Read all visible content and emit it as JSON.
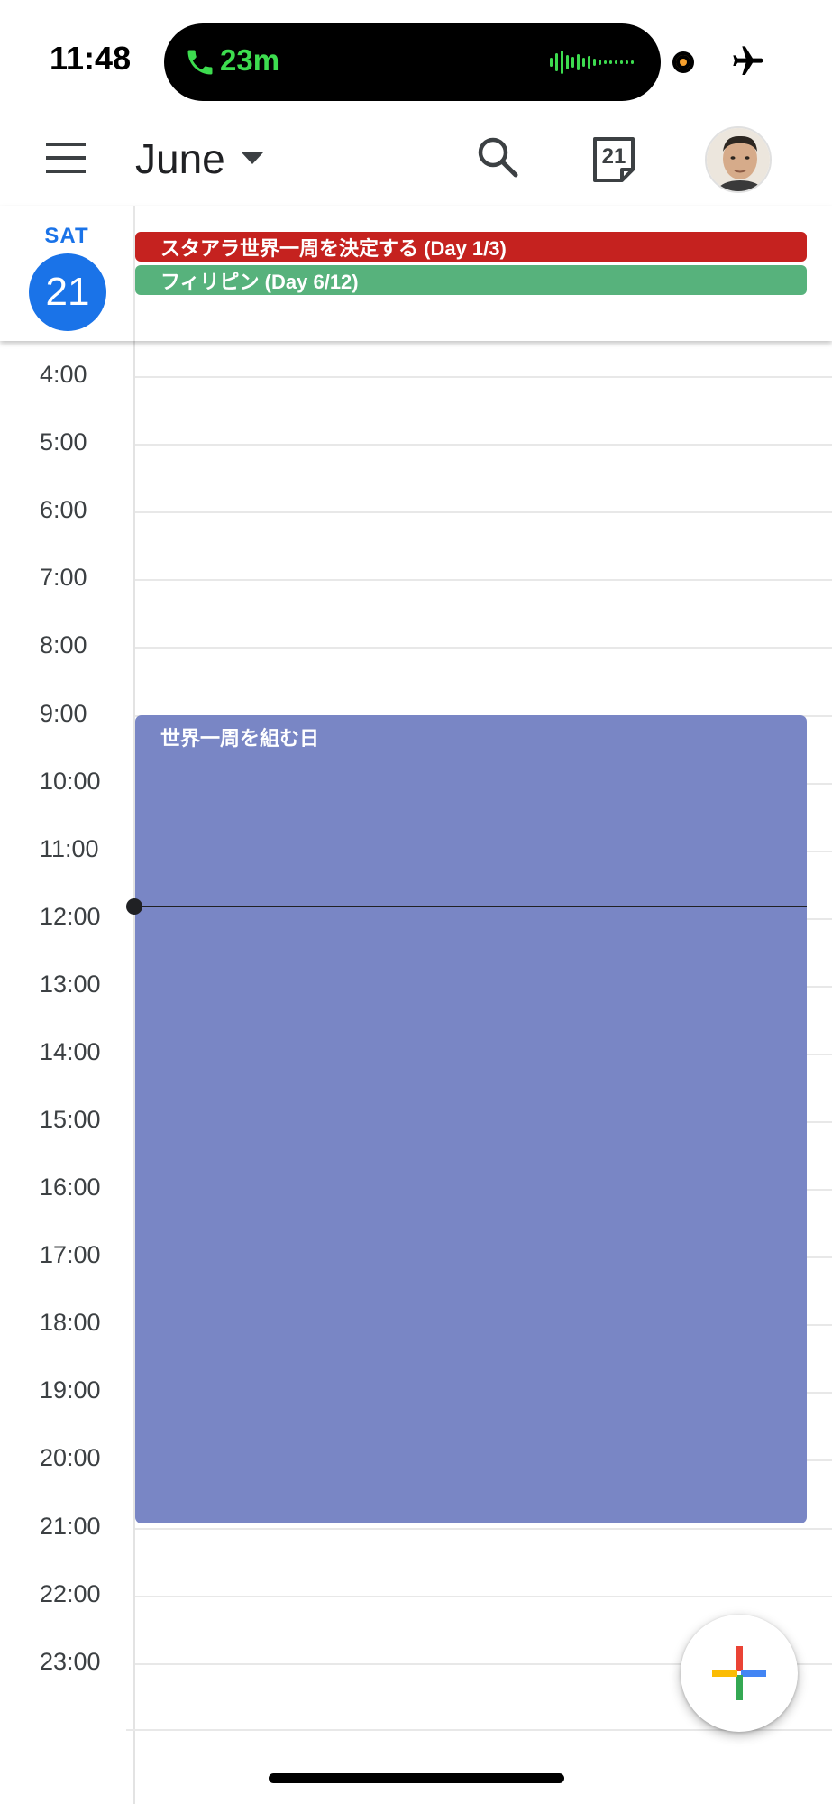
{
  "status_bar": {
    "time": "11:48",
    "call_duration": "23m",
    "icons": [
      "phone-icon",
      "audio-wave-icon",
      "orange-dot-icon",
      "airplane-icon"
    ]
  },
  "app_bar": {
    "month": "June",
    "icons": [
      "menu-icon",
      "dropdown-caret-icon",
      "search-icon",
      "today-calendar-icon",
      "avatar"
    ],
    "today_date": "21"
  },
  "day": {
    "weekday": "SAT",
    "number": "21"
  },
  "all_day_events": [
    {
      "title": "スタアラ世界一周を決定する (Day 1/3)",
      "color": "#c5221f"
    },
    {
      "title": "フィリピン (Day 6/12)",
      "color": "#57b27c"
    }
  ],
  "hours": [
    "4:00",
    "5:00",
    "6:00",
    "7:00",
    "8:00",
    "9:00",
    "10:00",
    "11:00",
    "12:00",
    "13:00",
    "14:00",
    "15:00",
    "16:00",
    "17:00",
    "18:00",
    "19:00",
    "20:00",
    "21:00",
    "22:00",
    "23:00"
  ],
  "timed_events": [
    {
      "title": "世界一周を組む日",
      "start": "9:00",
      "end": "21:00",
      "color": "#7986c5"
    }
  ],
  "current_time_indicator": "11:48",
  "fab": {
    "icon": "plus-icon"
  },
  "colors": {
    "accent": "#1a73e8",
    "event_red": "#c5221f",
    "event_green": "#57b27c",
    "event_lavender": "#7986c5"
  }
}
